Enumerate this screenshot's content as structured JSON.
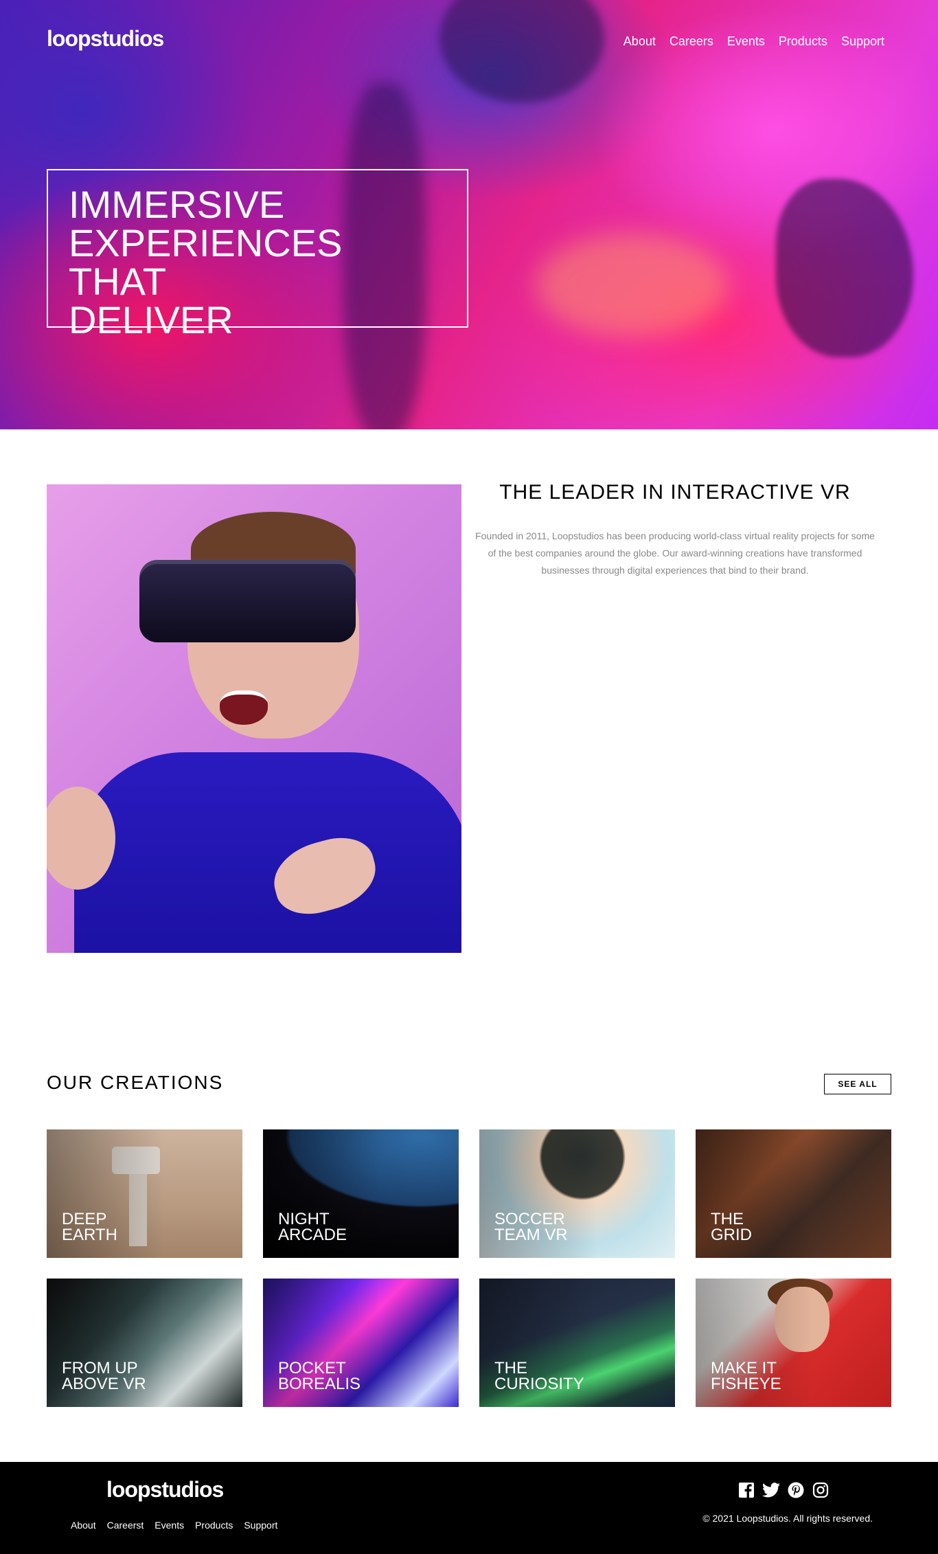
{
  "header": {
    "logo": "loopstudios",
    "nav": [
      "About",
      "Careers",
      "Events",
      "Products",
      "Support"
    ]
  },
  "hero": {
    "title": "IMMERSIVE\nEXPERIENCES THAT\nDELIVER"
  },
  "intro": {
    "heading": "THE LEADER IN INTERACTIVE VR",
    "body": "Founded in 2011, Loopstudios has been producing world-class virtual reality projects for some of the best companies around the globe. Our award-winning creations have transformed businesses through digital experiences that bind to their brand."
  },
  "creations": {
    "title": "OUR CREATIONS",
    "see_all": "SEE ALL",
    "items": [
      {
        "label": "DEEP\nEARTH"
      },
      {
        "label": "NIGHT\nARCADE"
      },
      {
        "label": "SOCCER\nTEAM VR"
      },
      {
        "label": "THE\nGRID"
      },
      {
        "label": "FROM UP\nABOVE VR"
      },
      {
        "label": "POCKET\nBOREALIS"
      },
      {
        "label": "THE\nCURIOSITY"
      },
      {
        "label": "MAKE IT\nFISHEYE"
      }
    ]
  },
  "footer": {
    "logo": "loopstudios",
    "nav": [
      "About",
      "Careerst",
      "Events",
      "Products",
      "Support"
    ],
    "social_icons": [
      "facebook-icon",
      "twitter-icon",
      "pinterest-icon",
      "instagram-icon"
    ],
    "copyright": "© 2021 Loopstudios. All rights reserved."
  },
  "colors": {
    "footer_bg": "#000000",
    "text_muted": "#888888",
    "hero_accent": "#e63bd9"
  }
}
